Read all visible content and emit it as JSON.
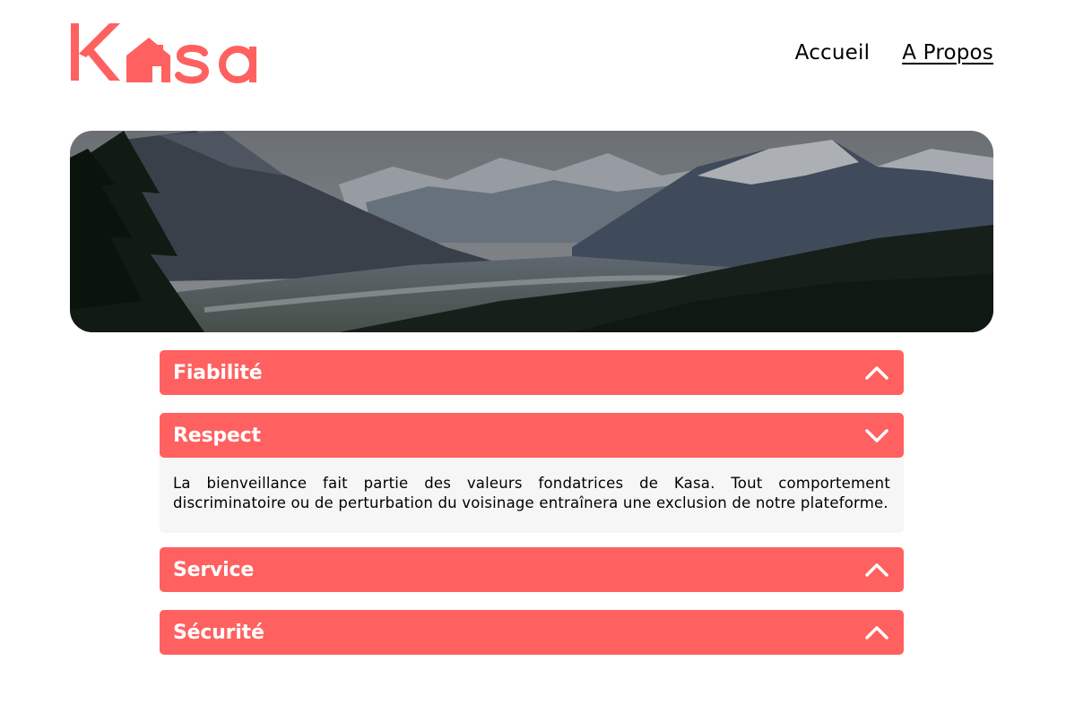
{
  "header": {
    "logo_text": "Kasa",
    "nav": [
      {
        "label": "Accueil",
        "active": false
      },
      {
        "label": "A Propos",
        "active": true
      }
    ]
  },
  "colors": {
    "brand": "#FF6060",
    "body_bg": "#F6F6F6"
  },
  "accordion": [
    {
      "title": "Fiabilité",
      "open": false,
      "icon": "chevron-up-icon"
    },
    {
      "title": "Respect",
      "open": true,
      "icon": "chevron-down-icon",
      "text": "La bienveillance fait partie des valeurs fondatrices de Kasa. Tout comportement discriminatoire ou de perturbation du voisinage entraînera une exclusion de notre plateforme."
    },
    {
      "title": "Service",
      "open": false,
      "icon": "chevron-up-icon"
    },
    {
      "title": "Sécurité",
      "open": false,
      "icon": "chevron-up-icon"
    }
  ]
}
